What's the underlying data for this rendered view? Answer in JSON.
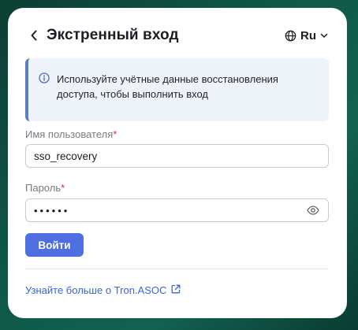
{
  "header": {
    "title": "Экстренный вход",
    "language": "Ru"
  },
  "info": {
    "text": "Используйте учётные данные восстановления доступа, чтобы выполнить вход"
  },
  "form": {
    "username_label": "Имя пользователя",
    "username_value": "sso_recovery",
    "password_label": "Пароль",
    "password_mask": "••••••",
    "required_mark": "*"
  },
  "actions": {
    "submit_label": "Войти"
  },
  "footer": {
    "link_text": "Узнайте больше о Tron.ASOC"
  },
  "icons": {
    "back": "chevron-left-icon",
    "language": "globe-icon",
    "dropdown": "chevron-down-icon",
    "info": "info-icon",
    "eye": "eye-icon",
    "external": "external-link-icon"
  },
  "colors": {
    "accent": "#4f6fe0",
    "link": "#3b64d8",
    "info_background": "#eef3fa",
    "info_border": "#5b7fc0",
    "required": "#d62a3a"
  }
}
